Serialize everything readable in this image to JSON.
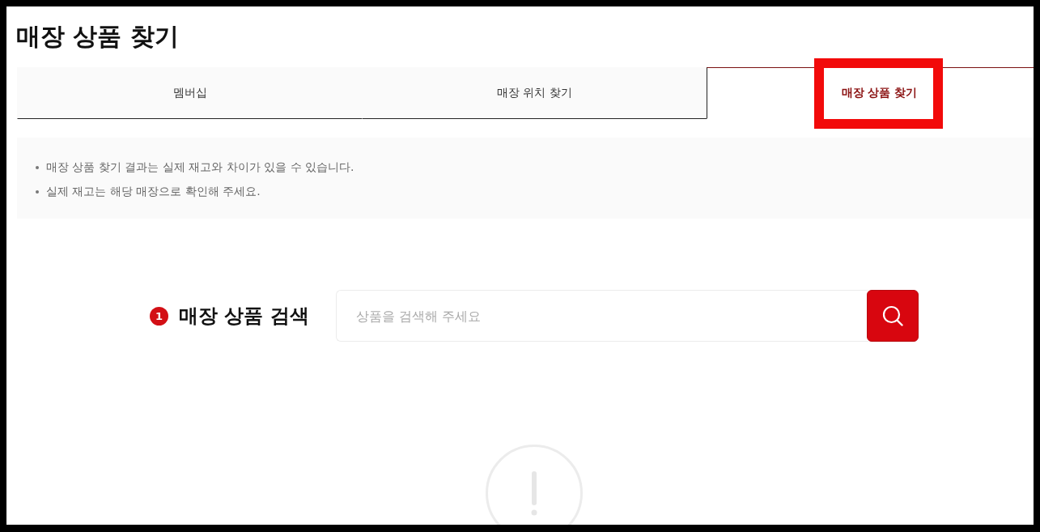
{
  "page_title": "매장 상품 찾기",
  "tabs": [
    {
      "label": "멤버십",
      "selected": false,
      "highlighted": false
    },
    {
      "label": "매장 위치 찾기",
      "selected": false,
      "highlighted": false
    },
    {
      "label": "매장 상품 찾기",
      "selected": true,
      "highlighted": true
    }
  ],
  "notices": [
    "매장 상품 찾기 결과는 실제 재고와 차이가 있을 수 있습니다.",
    "실제 재고는 해당 매장으로 확인해 주세요."
  ],
  "search": {
    "step": "1",
    "label": "매장 상품 검색",
    "placeholder": "상품을 검색해 주세요"
  }
}
